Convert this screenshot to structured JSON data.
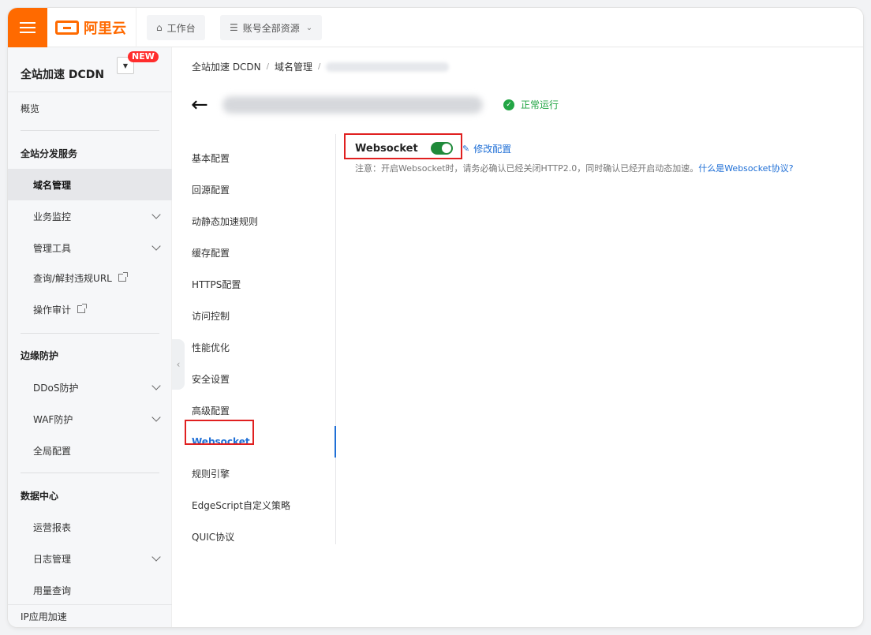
{
  "topbar": {
    "brand": "阿里云",
    "workbench": "工作台",
    "resources": "账号全部资源"
  },
  "sidebar": {
    "title": "全站加速 DCDN",
    "new_badge": "NEW",
    "overview": "概览",
    "groups": [
      {
        "label": "全站分发服务",
        "items": [
          "域名管理",
          "业务监控",
          "管理工具",
          "查询/解封违规URL",
          "操作审计"
        ]
      },
      {
        "label": "边缘防护",
        "items": [
          "DDoS防护",
          "WAF防护",
          "全局配置"
        ]
      },
      {
        "label": "数据中心",
        "items": [
          "运营报表",
          "日志管理",
          "用量查询"
        ]
      }
    ],
    "bottom": "IP应用加速"
  },
  "breadcrumb": [
    "全站加速 DCDN",
    "域名管理"
  ],
  "status": "正常运行",
  "subnav": [
    "基本配置",
    "回源配置",
    "动静态加速规则",
    "缓存配置",
    "HTTPS配置",
    "访问控制",
    "性能优化",
    "安全设置",
    "高级配置",
    "Websocket",
    "规则引擎",
    "EdgeScript自定义策略",
    "QUIC协议"
  ],
  "websocket": {
    "label": "Websocket",
    "enabled": true,
    "edit": "修改配置",
    "note": "注意：开启Websocket时，请务必确认已经关闭HTTP2.0，同时确认已经开启动态加速。",
    "note_link": "什么是Websocket协议?"
  },
  "colors": {
    "brand": "#ff6a00",
    "link": "#1f6fd6",
    "success": "#23a645",
    "toggle_on": "#1f8a3a",
    "highlight": "#e02020"
  }
}
